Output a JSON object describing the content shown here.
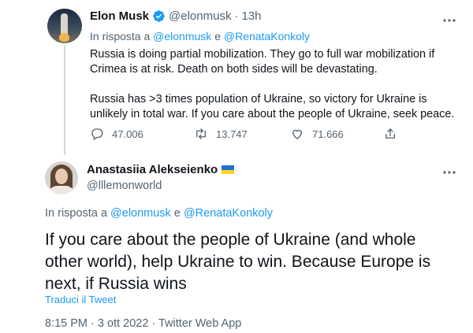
{
  "tweets": [
    {
      "author_name": "Elon Musk",
      "handle": "@elonmusk",
      "separator": "·",
      "time": "13h",
      "reply_prefix": "In risposta a",
      "reply_to_1": "@elonmusk",
      "reply_conj": "e",
      "reply_to_2": "@RenataKonkoly",
      "text": "Russia is doing partial mobilization. They go to full war mobilization if Crimea is at risk. Death on both sides will be devastating.\n\nRussia has >3 times population of Ukraine, so victory for Ukraine is unlikely in total war. If you care about the people of Ukraine, seek peace.",
      "replies": "47.006",
      "retweets": "13.747",
      "likes": "71.666",
      "verified": true
    },
    {
      "author_name": "Anastasiia Alekseienko",
      "handle": "@lllemonworld",
      "reply_prefix": "In risposta a",
      "reply_to_1": "@elonmusk",
      "reply_conj": "e",
      "reply_to_2": "@RenataKonkoly",
      "text": "If you care about the people of Ukraine (and whole other world), help Ukraine to win. Because Europe is next, if Russia wins",
      "translate_label": "Traduci il Tweet",
      "timestamp": "8:15 PM · 3 ott 2022 · Twitter Web App"
    }
  ],
  "icons": [
    "more-icon",
    "verified-icon",
    "reply-icon",
    "retweet-icon",
    "like-icon",
    "share-icon",
    "ukraine-flag-icon"
  ],
  "colors": {
    "link": "#1d9bf0",
    "secondary_text": "#536471",
    "primary_text": "#0f1419",
    "thread_line": "#cfd9de",
    "verified": "#1d9bf0"
  }
}
